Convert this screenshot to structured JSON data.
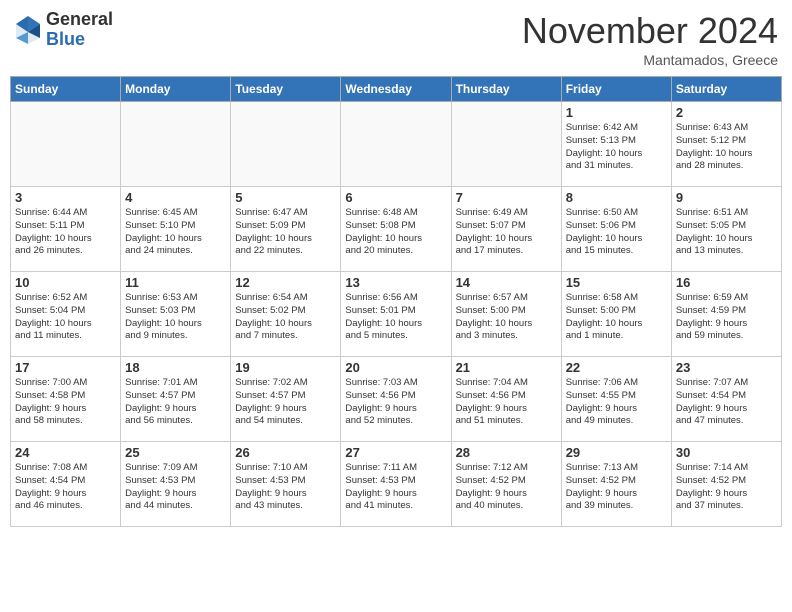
{
  "header": {
    "logo_general": "General",
    "logo_blue": "Blue",
    "month_title": "November 2024",
    "subtitle": "Mantamados, Greece"
  },
  "days_of_week": [
    "Sunday",
    "Monday",
    "Tuesday",
    "Wednesday",
    "Thursday",
    "Friday",
    "Saturday"
  ],
  "weeks": [
    [
      {
        "day": "",
        "info": ""
      },
      {
        "day": "",
        "info": ""
      },
      {
        "day": "",
        "info": ""
      },
      {
        "day": "",
        "info": ""
      },
      {
        "day": "",
        "info": ""
      },
      {
        "day": "1",
        "info": "Sunrise: 6:42 AM\nSunset: 5:13 PM\nDaylight: 10 hours\nand 31 minutes."
      },
      {
        "day": "2",
        "info": "Sunrise: 6:43 AM\nSunset: 5:12 PM\nDaylight: 10 hours\nand 28 minutes."
      }
    ],
    [
      {
        "day": "3",
        "info": "Sunrise: 6:44 AM\nSunset: 5:11 PM\nDaylight: 10 hours\nand 26 minutes."
      },
      {
        "day": "4",
        "info": "Sunrise: 6:45 AM\nSunset: 5:10 PM\nDaylight: 10 hours\nand 24 minutes."
      },
      {
        "day": "5",
        "info": "Sunrise: 6:47 AM\nSunset: 5:09 PM\nDaylight: 10 hours\nand 22 minutes."
      },
      {
        "day": "6",
        "info": "Sunrise: 6:48 AM\nSunset: 5:08 PM\nDaylight: 10 hours\nand 20 minutes."
      },
      {
        "day": "7",
        "info": "Sunrise: 6:49 AM\nSunset: 5:07 PM\nDaylight: 10 hours\nand 17 minutes."
      },
      {
        "day": "8",
        "info": "Sunrise: 6:50 AM\nSunset: 5:06 PM\nDaylight: 10 hours\nand 15 minutes."
      },
      {
        "day": "9",
        "info": "Sunrise: 6:51 AM\nSunset: 5:05 PM\nDaylight: 10 hours\nand 13 minutes."
      }
    ],
    [
      {
        "day": "10",
        "info": "Sunrise: 6:52 AM\nSunset: 5:04 PM\nDaylight: 10 hours\nand 11 minutes."
      },
      {
        "day": "11",
        "info": "Sunrise: 6:53 AM\nSunset: 5:03 PM\nDaylight: 10 hours\nand 9 minutes."
      },
      {
        "day": "12",
        "info": "Sunrise: 6:54 AM\nSunset: 5:02 PM\nDaylight: 10 hours\nand 7 minutes."
      },
      {
        "day": "13",
        "info": "Sunrise: 6:56 AM\nSunset: 5:01 PM\nDaylight: 10 hours\nand 5 minutes."
      },
      {
        "day": "14",
        "info": "Sunrise: 6:57 AM\nSunset: 5:00 PM\nDaylight: 10 hours\nand 3 minutes."
      },
      {
        "day": "15",
        "info": "Sunrise: 6:58 AM\nSunset: 5:00 PM\nDaylight: 10 hours\nand 1 minute."
      },
      {
        "day": "16",
        "info": "Sunrise: 6:59 AM\nSunset: 4:59 PM\nDaylight: 9 hours\nand 59 minutes."
      }
    ],
    [
      {
        "day": "17",
        "info": "Sunrise: 7:00 AM\nSunset: 4:58 PM\nDaylight: 9 hours\nand 58 minutes."
      },
      {
        "day": "18",
        "info": "Sunrise: 7:01 AM\nSunset: 4:57 PM\nDaylight: 9 hours\nand 56 minutes."
      },
      {
        "day": "19",
        "info": "Sunrise: 7:02 AM\nSunset: 4:57 PM\nDaylight: 9 hours\nand 54 minutes."
      },
      {
        "day": "20",
        "info": "Sunrise: 7:03 AM\nSunset: 4:56 PM\nDaylight: 9 hours\nand 52 minutes."
      },
      {
        "day": "21",
        "info": "Sunrise: 7:04 AM\nSunset: 4:56 PM\nDaylight: 9 hours\nand 51 minutes."
      },
      {
        "day": "22",
        "info": "Sunrise: 7:06 AM\nSunset: 4:55 PM\nDaylight: 9 hours\nand 49 minutes."
      },
      {
        "day": "23",
        "info": "Sunrise: 7:07 AM\nSunset: 4:54 PM\nDaylight: 9 hours\nand 47 minutes."
      }
    ],
    [
      {
        "day": "24",
        "info": "Sunrise: 7:08 AM\nSunset: 4:54 PM\nDaylight: 9 hours\nand 46 minutes."
      },
      {
        "day": "25",
        "info": "Sunrise: 7:09 AM\nSunset: 4:53 PM\nDaylight: 9 hours\nand 44 minutes."
      },
      {
        "day": "26",
        "info": "Sunrise: 7:10 AM\nSunset: 4:53 PM\nDaylight: 9 hours\nand 43 minutes."
      },
      {
        "day": "27",
        "info": "Sunrise: 7:11 AM\nSunset: 4:53 PM\nDaylight: 9 hours\nand 41 minutes."
      },
      {
        "day": "28",
        "info": "Sunrise: 7:12 AM\nSunset: 4:52 PM\nDaylight: 9 hours\nand 40 minutes."
      },
      {
        "day": "29",
        "info": "Sunrise: 7:13 AM\nSunset: 4:52 PM\nDaylight: 9 hours\nand 39 minutes."
      },
      {
        "day": "30",
        "info": "Sunrise: 7:14 AM\nSunset: 4:52 PM\nDaylight: 9 hours\nand 37 minutes."
      }
    ]
  ]
}
